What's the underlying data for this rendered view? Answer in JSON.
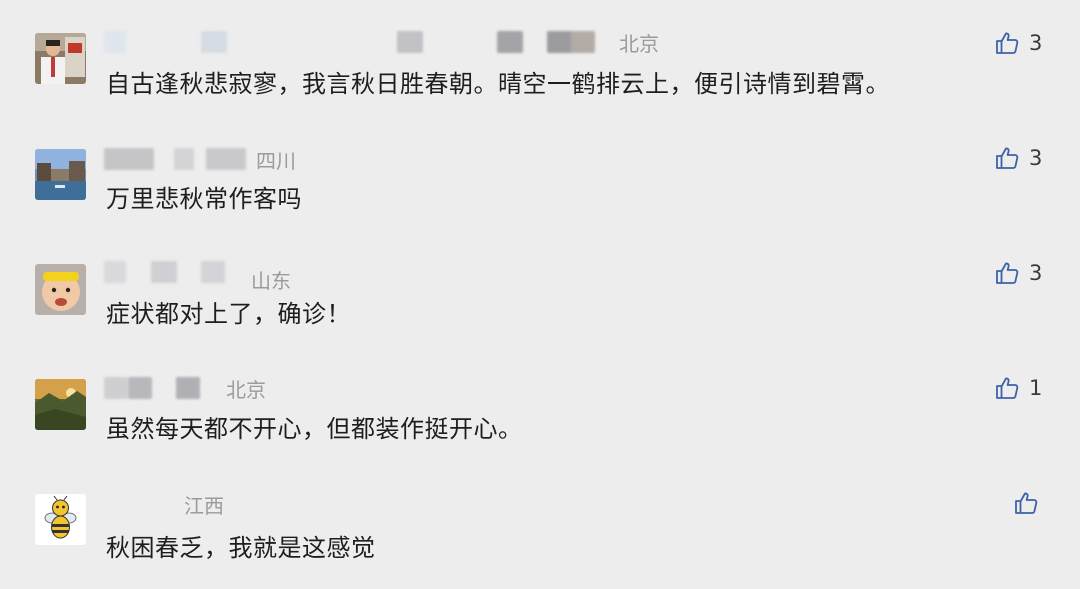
{
  "comments": [
    {
      "location": "北京",
      "text": "自古逢秋悲寂寥，我言秋日胜春朝。晴空一鹤排云上，便引诗情到碧霄。",
      "likes": "3",
      "avatar_icon": "person-portrait-icon"
    },
    {
      "location": "四川",
      "text": "万里悲秋常作客吗",
      "likes": "3",
      "avatar_icon": "canal-town-photo-icon"
    },
    {
      "location": "山东",
      "text": "症状都对上了，确诊！",
      "likes": "3",
      "avatar_icon": "child-with-headband-icon"
    },
    {
      "location": "北京",
      "text": "虽然每天都不开心，但都装作挺开心。",
      "likes": "1",
      "avatar_icon": "mountain-sunset-photo-icon"
    },
    {
      "location": "江西",
      "text": "秋困春乏，我就是这感觉",
      "likes": "",
      "avatar_icon": "cartoon-bee-icon"
    }
  ],
  "colors": {
    "background": "#ededed",
    "text": "#1e1e1e",
    "location": "#9b9b9b",
    "like_icon": "#3d62a8"
  }
}
